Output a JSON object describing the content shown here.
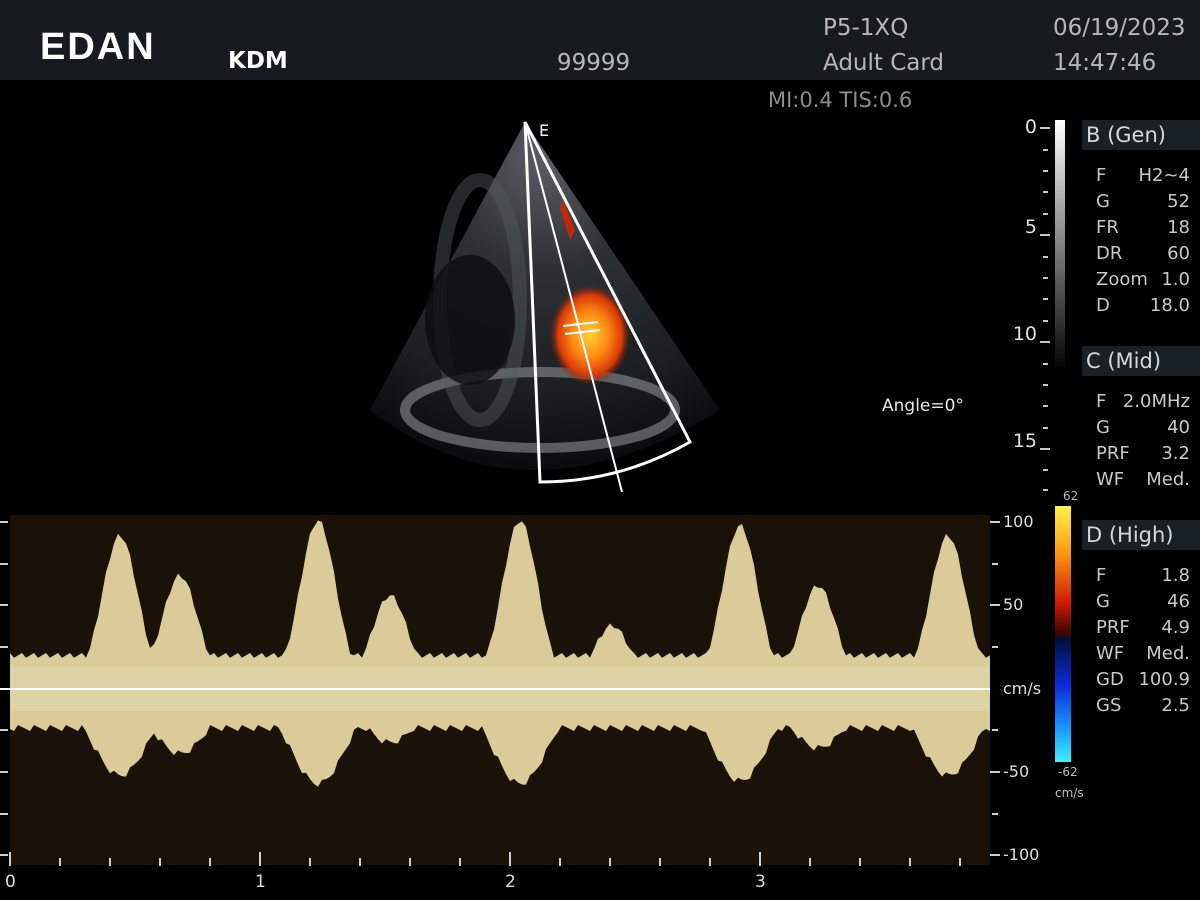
{
  "header": {
    "logo": "EDAN",
    "hospital": "KDM",
    "patient_id": "99999",
    "probe": "P5-1XQ",
    "exam": "Adult Card",
    "date": "06/19/2023",
    "time": "14:47:46"
  },
  "safety": "MI:0.4 TIS:0.6",
  "image": {
    "sector_marker": "E",
    "angle": "Angle=0°",
    "depth_scale": [
      "0",
      "5",
      "10",
      "15"
    ]
  },
  "params": {
    "b": {
      "title": "B (Gen)",
      "rows": [
        {
          "label": "F",
          "value": "H2~4"
        },
        {
          "label": "G",
          "value": "52"
        },
        {
          "label": "FR",
          "value": "18"
        },
        {
          "label": "DR",
          "value": "60"
        },
        {
          "label": "Zoom",
          "value": "1.0"
        },
        {
          "label": "D",
          "value": "18.0"
        }
      ]
    },
    "c": {
      "title": "C (Mid)",
      "rows": [
        {
          "label": "F",
          "value": "2.0MHz"
        },
        {
          "label": "G",
          "value": "40"
        },
        {
          "label": "PRF",
          "value": "3.2"
        },
        {
          "label": "WF",
          "value": "Med."
        }
      ]
    },
    "d": {
      "title": "D (High)",
      "rows": [
        {
          "label": "F",
          "value": "1.8"
        },
        {
          "label": "G",
          "value": "46"
        },
        {
          "label": "PRF",
          "value": "4.9"
        },
        {
          "label": "WF",
          "value": "Med."
        },
        {
          "label": "GD",
          "value": "100.9"
        },
        {
          "label": "GS",
          "value": "2.5"
        }
      ]
    }
  },
  "color_bar": {
    "max": "62",
    "min": "-62",
    "unit": "cm/s"
  },
  "doppler": {
    "velocity_labels": [
      "100",
      "50",
      "cm/s",
      "-50",
      "-100"
    ],
    "time_labels": [
      "0",
      "1",
      "2",
      "3"
    ]
  },
  "colors": {
    "header_bg": "#151b1f",
    "panel_bg": "#1a2126",
    "spectrum": "#efe0a8"
  }
}
